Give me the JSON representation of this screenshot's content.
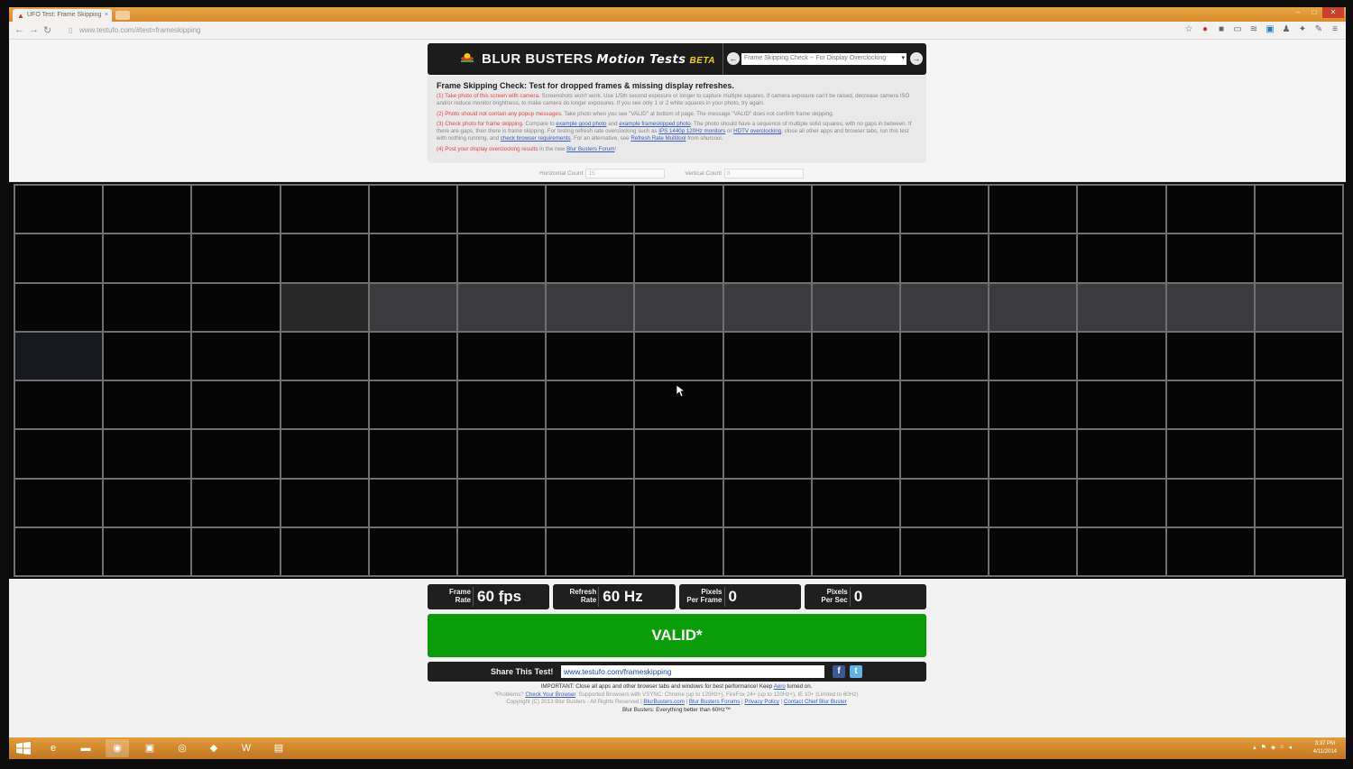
{
  "browser": {
    "tab_title": "UFO Test: Frame Skipping",
    "url": "www.testufo.com/#test=frameskipping"
  },
  "header": {
    "logo_main": "BLUR  BUSTERS",
    "logo_motion": "Motion Tests",
    "logo_beta": "BETA",
    "test_select": "Frame Skipping Check -- For Display Overclocking"
  },
  "info": {
    "title": "Frame Skipping Check:  Test for dropped frames & missing display refreshes.",
    "p1_red": "(1) Take photo of this screen with camera.",
    "p1_text": " Screenshots won't work. Use 1/5th second exposure or longer to capture multiple squares. If camera exposure can't be raised, decrease camera ISO and/or reduce monitor brightness, to make camera do longer exposures. If you see only 1 or 2 white squares in your photo, try again.",
    "p2_red": "(2) Photo should not contain any popup messages.",
    "p2_text": " Take photo when you see \"VALID\" at bottom of page. The message \"VALID\" does not confirm frame skipping.",
    "p3_red": "(3) Check photo for frame skipping.",
    "p3_a": " Compare to ",
    "p3_link1": "example good photo",
    "p3_b": " and ",
    "p3_link2": "example frameskipped photo",
    "p3_c": ". The photo should have a sequence of multiple solid squares, with no gaps in between. If there are gaps, then there is frame skipping. For testing refresh rate overclocking such as ",
    "p3_link3": "IPS 1440p 120Hz monitors",
    "p3_d": " or ",
    "p3_link4": "HDTV overclocking",
    "p3_e": ", close all other apps and browser tabs, run this test with nothing running, and ",
    "p3_link5": "check browser requirements",
    "p3_f": ". For an alternative, see ",
    "p3_link6": "Refresh Rate Multitool",
    "p3_g": " from shurcool.",
    "p4_red": "(4) Post your display overclocking results",
    "p4_a": " in the new ",
    "p4_link": "Blur Busters Forum",
    "p4_b": "!"
  },
  "counts": {
    "horizontal_label": "Horizontal Count",
    "horizontal_value": "15",
    "vertical_label": "Vertical Count",
    "vertical_value": "8"
  },
  "grid": {
    "columns": 15,
    "rows": 8,
    "lit_row": 3,
    "lit_from_col": 5,
    "dim_cell": [
      3,
      4
    ],
    "faint_cell": [
      4,
      1
    ]
  },
  "stats": [
    {
      "label_line1": "Frame",
      "label_line2": "Rate",
      "value": "60 fps"
    },
    {
      "label_line1": "Refresh",
      "label_line2": "Rate",
      "value": "60 Hz"
    },
    {
      "label_line1": "Pixels",
      "label_line2": "Per Frame",
      "value": "0"
    },
    {
      "label_line1": "Pixels",
      "label_line2": "Per Sec",
      "value": "0"
    }
  ],
  "status": "VALID*",
  "share": {
    "label": "Share This Test!",
    "url": "www.testufo.com/frameskipping",
    "facebook": "f",
    "twitter": "t"
  },
  "footer": {
    "line1_a": "IMPORTANT: Close all apps and other browser tabs and windows for best performance! Keep ",
    "line1_link": "Aero",
    "line1_b": " turned on.",
    "line2_a": "*Problems? ",
    "line2_link": "Check Your Browser",
    "line2_b": ". Supported Browsers with VSYNC: Chrome (up to 120Hz+), FireFox 24+ (up to 120Hz+), IE 10+ (Limited to 60Hz)",
    "line3_a": "Copyright (C) 2013 Blur Busters - All Rights Reserved | ",
    "line3_link1": "BlurBusters.com",
    "line3_b": " | ",
    "line3_link2": "Blur Busters Forums",
    "line3_c": " | ",
    "line3_link3": "Privacy Policy",
    "line3_d": " | ",
    "line3_link4": "Contact Chief Blur Buster",
    "line4": "Blur Busters: Everything better than 60Hz™"
  },
  "taskbar": {
    "clock_time": "3:37 PM",
    "clock_date": "4/11/2014"
  },
  "colors": {
    "valid_green": "#0a9d0a",
    "header_dark": "#1c1c1c",
    "taskbar_orange": "#d98a2a",
    "link_blue": "#3a5cc5",
    "warning_red": "#e0484a"
  }
}
